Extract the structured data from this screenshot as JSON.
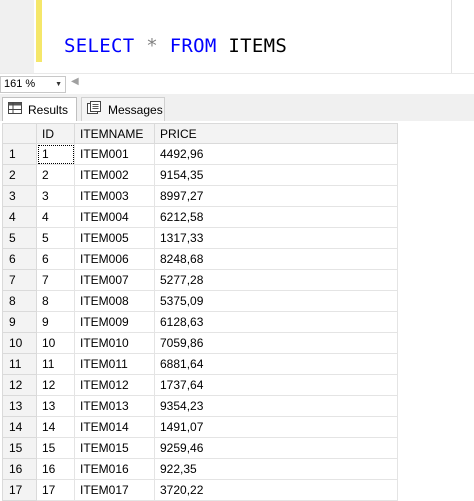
{
  "editor": {
    "tokens": [
      {
        "text": "SELECT",
        "kind": "kw"
      },
      {
        "text": " ",
        "kind": "id"
      },
      {
        "text": "*",
        "kind": "op"
      },
      {
        "text": " ",
        "kind": "id"
      },
      {
        "text": "FROM",
        "kind": "kw"
      },
      {
        "text": " ",
        "kind": "id"
      },
      {
        "text": "ITEMS",
        "kind": "id"
      }
    ]
  },
  "zoom": {
    "value": "161 %"
  },
  "tabs": [
    {
      "label": "Results",
      "icon": "grid-icon",
      "active": true
    },
    {
      "label": "Messages",
      "icon": "messages-icon",
      "active": false
    }
  ],
  "grid": {
    "columns": [
      "",
      "ID",
      "ITEMNAME",
      "PRICE"
    ],
    "rows": [
      [
        "1",
        "1",
        "ITEM001",
        "4492,96"
      ],
      [
        "2",
        "2",
        "ITEM002",
        "9154,35"
      ],
      [
        "3",
        "3",
        "ITEM003",
        "8997,27"
      ],
      [
        "4",
        "4",
        "ITEM004",
        "6212,58"
      ],
      [
        "5",
        "5",
        "ITEM005",
        "1317,33"
      ],
      [
        "6",
        "6",
        "ITEM006",
        "8248,68"
      ],
      [
        "7",
        "7",
        "ITEM007",
        "5277,28"
      ],
      [
        "8",
        "8",
        "ITEM008",
        "5375,09"
      ],
      [
        "9",
        "9",
        "ITEM009",
        "6128,63"
      ],
      [
        "10",
        "10",
        "ITEM010",
        "7059,86"
      ],
      [
        "11",
        "11",
        "ITEM011",
        "6881,64"
      ],
      [
        "12",
        "12",
        "ITEM012",
        "1737,64"
      ],
      [
        "13",
        "13",
        "ITEM013",
        "9354,23"
      ],
      [
        "14",
        "14",
        "ITEM014",
        "1491,07"
      ],
      [
        "15",
        "15",
        "ITEM015",
        "9259,46"
      ],
      [
        "16",
        "16",
        "ITEM016",
        "922,35"
      ],
      [
        "17",
        "17",
        "ITEM017",
        "3720,22"
      ]
    ]
  }
}
